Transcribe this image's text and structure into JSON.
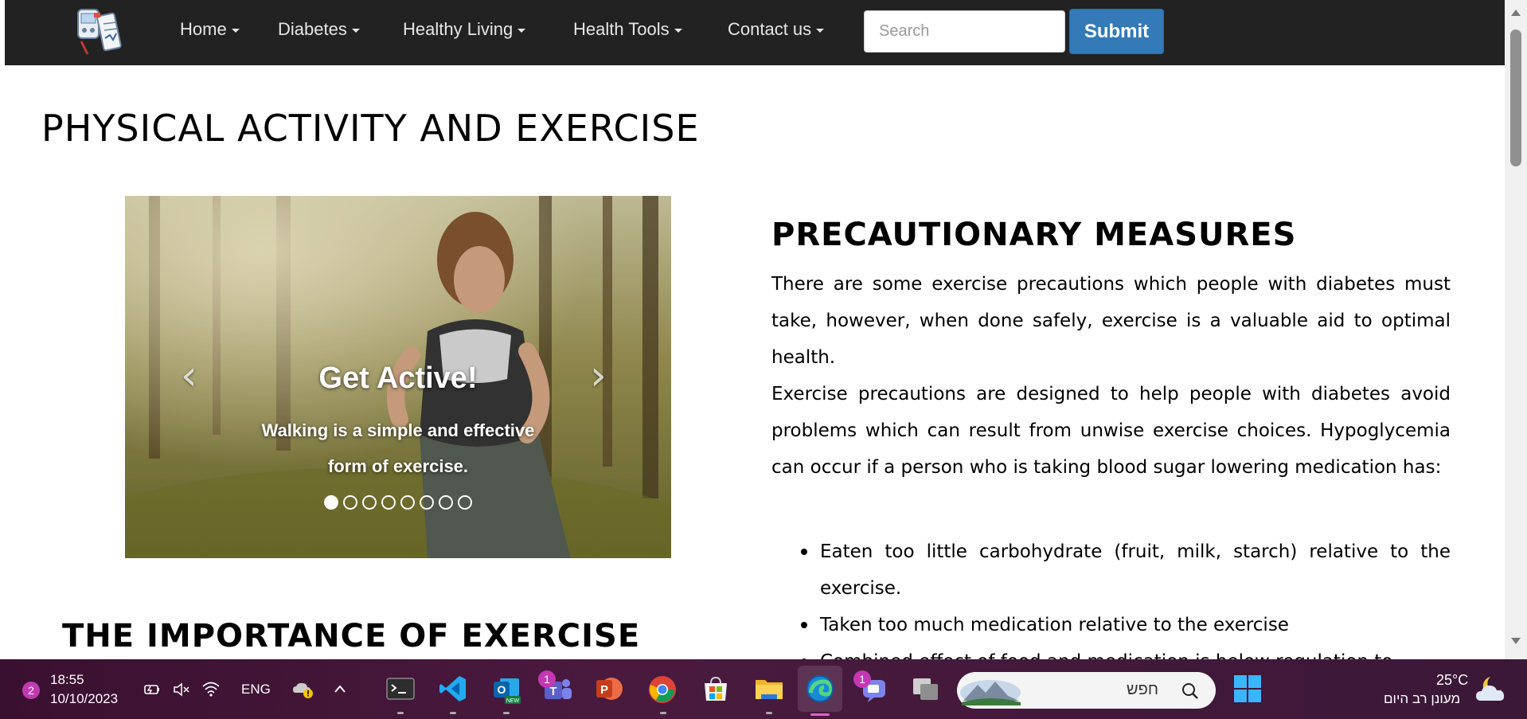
{
  "nav": {
    "items": [
      {
        "label": "Home"
      },
      {
        "label": "Diabetes"
      },
      {
        "label": "Healthy Living"
      },
      {
        "label": "Health Tools"
      },
      {
        "label": "Contact us"
      }
    ],
    "search_placeholder": "Search",
    "submit_label": "Submit"
  },
  "page": {
    "title": "PHYSICAL ACTIVITY AND EXERCISE",
    "sub_title": "THE IMPORTANCE OF EXERCISE"
  },
  "carousel": {
    "caption_title": "Get Active!",
    "caption_text": "Walking is a simple and effective form of exercise.",
    "prev_icon": "chevron-left-icon",
    "next_icon": "chevron-right-icon",
    "indicator_count": 8,
    "active_index": 0
  },
  "precautions": {
    "heading": "PRECAUTIONARY MEASURES",
    "para1": "There are some exercise precautions which people with diabetes must take, however, when done safely, exercise is a valuable aid to optimal health.",
    "para2": "Exercise precautions are designed to help people with diabetes avoid problems which can result from unwise exercise choices. Hypoglycemia can occur if a person who is taking blood sugar lowering medication has:",
    "bullets": [
      "Eaten too little carbohydrate (fruit, milk, starch) relative to the exercise.",
      "Taken too much medication relative to the exercise",
      "Combined effect of food and medication is below regulation to"
    ]
  },
  "taskbar": {
    "notification_count": "2",
    "time": "18:55",
    "date": "10/10/2023",
    "language": "ENG",
    "search_text": "חפש",
    "teams_badge": "1",
    "chat_badge": "1",
    "temperature": "25°C",
    "weather": "מעונן רב היום"
  },
  "colors": {
    "navbar": "#222222",
    "submit": "#337ab7",
    "taskbar": "#3a1030"
  }
}
